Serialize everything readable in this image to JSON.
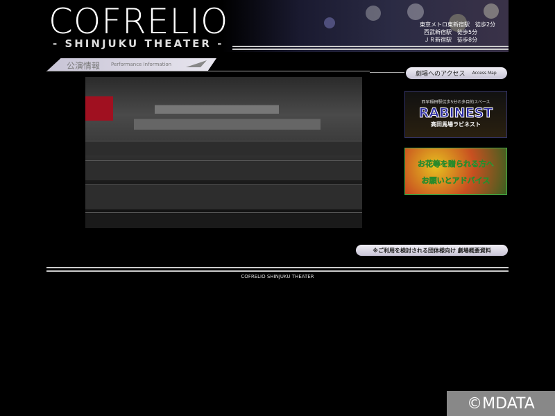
{
  "header": {
    "logo": "COFRELIO",
    "subtitle": "- SHINJUKU THEATER -",
    "access_lines": [
      "東京メトロ東新宿駅　徒歩2分",
      "西武新宿駅　徒歩5分",
      "ＪＲ新宿駅　徒歩8分"
    ]
  },
  "section": {
    "title_jp": "公演情報",
    "title_en": "Performance Information"
  },
  "sidebar": {
    "access_jp": "劇場へのアクセス",
    "access_en": "Access Map",
    "rabinest": {
      "top": "西早稲田駅徒歩5分の多目的スペース",
      "name": "RABINEST",
      "bottom": "高田馬場ラビネスト"
    },
    "flowers": {
      "line1": "お花等を贈られる方へ",
      "line2": "お願いとアドバイス"
    }
  },
  "group_link": "※ご利用を検討される団体様向け 劇場概要資料",
  "footer": "COFRELIO SHINJUKU THEATER",
  "watermark": "©MDATA"
}
